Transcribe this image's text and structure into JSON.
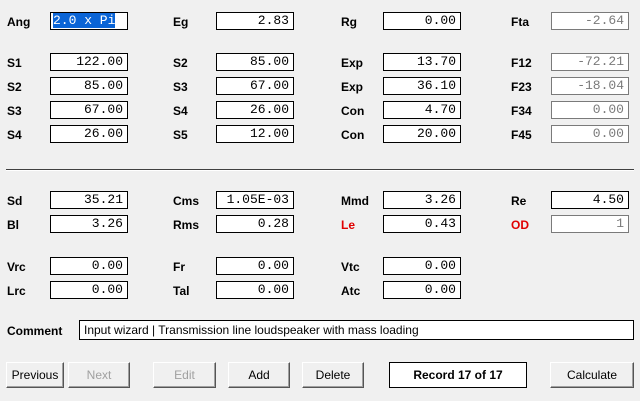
{
  "fields": [
    {
      "label": "Ang",
      "value": "2.0 x Pi"
    },
    {
      "label": "Eg",
      "value": "2.83"
    },
    {
      "label": "Rg",
      "value": "0.00"
    },
    {
      "label": "Fta",
      "value": "-2.64"
    },
    {
      "label": "S1",
      "value": "122.00"
    },
    {
      "label": "S2",
      "value": "85.00"
    },
    {
      "label": "Exp",
      "value": "13.70"
    },
    {
      "label": "F12",
      "value": "-72.21"
    },
    {
      "label": "S2",
      "value": "85.00"
    },
    {
      "label": "S3",
      "value": "67.00"
    },
    {
      "label": "Exp",
      "value": "36.10"
    },
    {
      "label": "F23",
      "value": "-18.04"
    },
    {
      "label": "S3",
      "value": "67.00"
    },
    {
      "label": "S4",
      "value": "26.00"
    },
    {
      "label": "Con",
      "value": "4.70"
    },
    {
      "label": "F34",
      "value": "0.00"
    },
    {
      "label": "S4",
      "value": "26.00"
    },
    {
      "label": "S5",
      "value": "12.00"
    },
    {
      "label": "Con",
      "value": "20.00"
    },
    {
      "label": "F45",
      "value": "0.00"
    },
    {
      "label": "Sd",
      "value": "35.21"
    },
    {
      "label": "Cms",
      "value": "1.05E-03"
    },
    {
      "label": "Mmd",
      "value": "3.26"
    },
    {
      "label": "Re",
      "value": "4.50"
    },
    {
      "label": "Bl",
      "value": "3.26"
    },
    {
      "label": "Rms",
      "value": "0.28"
    },
    {
      "label": "Le",
      "value": "0.43"
    },
    {
      "label": "OD",
      "value": "1"
    },
    {
      "label": "Vrc",
      "value": "0.00"
    },
    {
      "label": "Fr",
      "value": "0.00"
    },
    {
      "label": "Vtc",
      "value": "0.00"
    },
    {
      "label": "Lrc",
      "value": "0.00"
    },
    {
      "label": "Tal",
      "value": "0.00"
    },
    {
      "label": "Atc",
      "value": "0.00"
    }
  ],
  "comment": {
    "label": "Comment",
    "value": "Input wizard | Transmission line loudspeaker with mass loading"
  },
  "buttons": {
    "previous": "Previous",
    "next": "Next",
    "edit": "Edit",
    "add": "Add",
    "delete": "Delete",
    "calculate": "Calculate"
  },
  "record_text": "Record 17 of 17",
  "colors": {
    "window_bg": "#f0f0f0",
    "selection": "#0a64d6",
    "warning_label": "#e00000",
    "readonly_text": "#7a7a7a"
  }
}
